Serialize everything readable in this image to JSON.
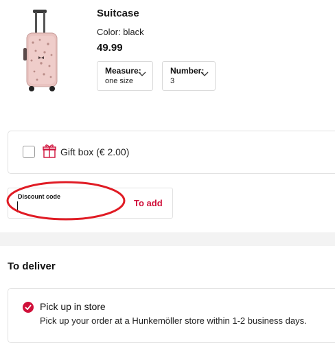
{
  "product": {
    "title": "Suitcase",
    "color": "Color: black",
    "price": "49.99",
    "measure": {
      "label": "Measure:",
      "value": "one size"
    },
    "number": {
      "label": "Number:",
      "value": "3"
    },
    "image_icon": "pink-suitcase-image"
  },
  "giftbox": {
    "label": "Gift box (€ 2.00)",
    "checked": false,
    "icon": "gift-icon"
  },
  "discount": {
    "label": "Discount code",
    "value": "",
    "add_label": "To add"
  },
  "delivery": {
    "title": "To deliver",
    "option": {
      "title": "Pick up in store",
      "description": "Pick up your order at a Hunkemöller store within 1-2 business days.",
      "selected": true
    }
  },
  "colors": {
    "accent": "#d0103a",
    "annotation": "#e01b24",
    "border": "#e1e1e1"
  }
}
